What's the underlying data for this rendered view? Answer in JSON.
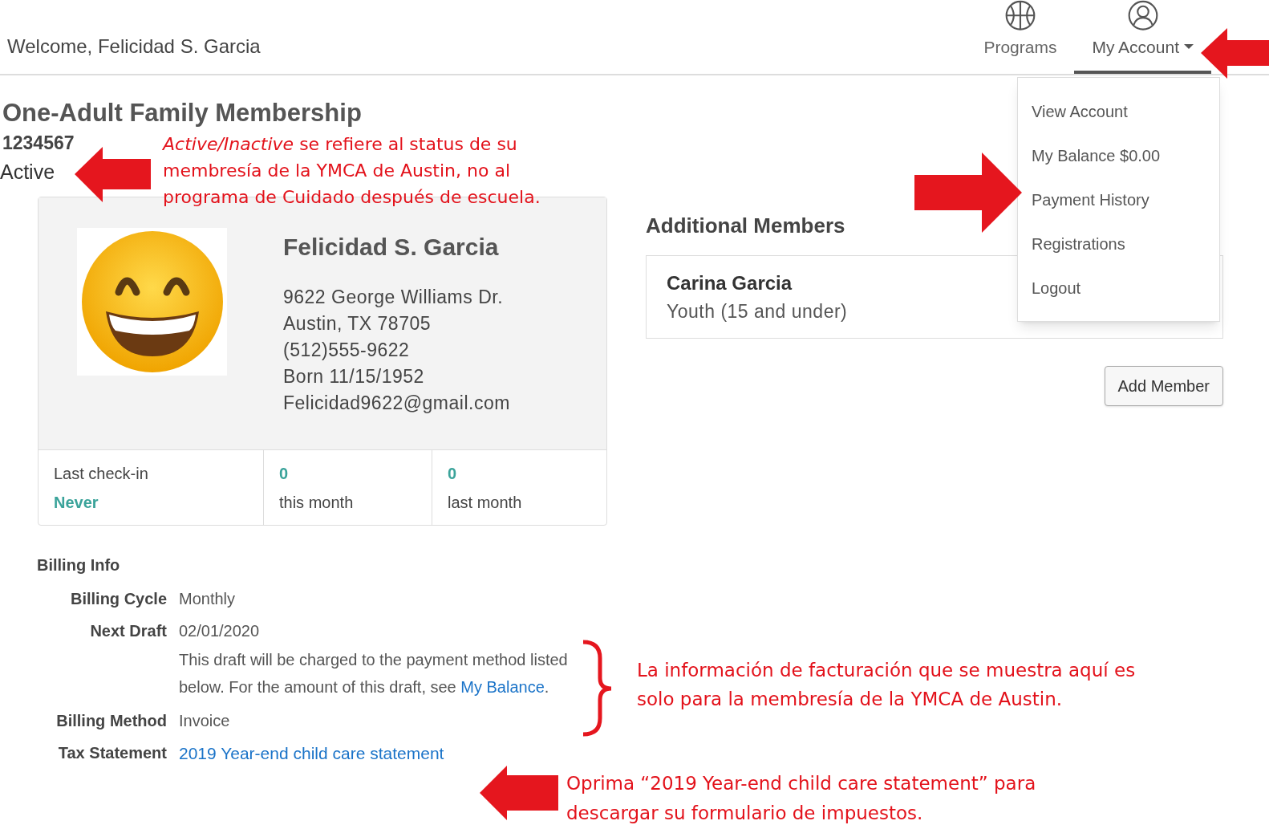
{
  "header": {
    "welcome": "Welcome, Felicidad S. Garcia",
    "nav": [
      {
        "label": "Programs",
        "kind": "programs",
        "selected": false,
        "caret": false
      },
      {
        "label": "My Account",
        "kind": "account",
        "selected": true,
        "caret": true
      }
    ]
  },
  "account_menu": {
    "expanded": true,
    "items": [
      "View Account",
      "My Balance $0.00",
      "Payment History",
      "Registrations",
      "Logout"
    ]
  },
  "membership": {
    "title": "One-Adult Family Membership",
    "number": "1234567",
    "status": "Active"
  },
  "profile": {
    "name": "Felicidad S. Garcia",
    "details": [
      "9622 George Williams Dr.",
      "Austin, TX 78705",
      "(512)555-9622",
      "Born 11/15/1952",
      "Felicidad9622@gmail.com"
    ],
    "stats": [
      {
        "kind": "label_first",
        "label": "Last check-in",
        "value": "Never"
      },
      {
        "kind": "value_first",
        "label": "this month",
        "value": "0"
      },
      {
        "kind": "value_first",
        "label": "last month",
        "value": "0"
      }
    ]
  },
  "additional_members": {
    "heading": "Additional Members",
    "members": [
      {
        "name": "Carina Garcia",
        "category": "Youth (15 and under)"
      }
    ],
    "add_button": "Add Member"
  },
  "billing": {
    "heading": "Billing Info",
    "rows": [
      {
        "kind": "text",
        "label": "Billing Cycle",
        "value": "Monthly"
      },
      {
        "kind": "note",
        "label": "Next Draft",
        "value": "02/01/2020",
        "note": "This draft will be charged to the payment method listed below. For the amount of this draft, see ",
        "note_link": "My Balance",
        "note_end": "."
      },
      {
        "kind": "text",
        "label": "Billing Method",
        "value": "Invoice"
      },
      {
        "kind": "link",
        "label": "Tax Statement",
        "value": "2019 Year-end child care statement"
      }
    ]
  },
  "annotations": [
    "*Active/Inactive* se refiere al status de su membresía de la YMCA de Austin, no al programa de Cuidado después de escuela.",
    "La información de facturación que se muestra aquí es solo para la membresía de la YMCA de Austin.",
    "Oprima “2019 Year-end child care statement” para descargar su formulario de impuestos."
  ]
}
